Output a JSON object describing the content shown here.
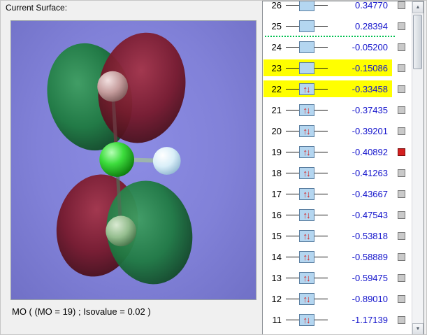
{
  "colors": {
    "viewer_bg": "#8181d8",
    "highlight": "#ffff00",
    "energy_text": "#1414cc",
    "row_line": "#1a1a1a",
    "box_fill": "#b4d6f0",
    "box_border": "#5a7ea0",
    "arrow": "#d42020",
    "checkbox_fill": "#c9c9c9",
    "checkbox_border": "#777777",
    "checkbox_selected": "#d42020",
    "separator": "#00c050"
  },
  "header": {
    "label": "Current Surface:"
  },
  "viewer": {
    "caption": "MO ( (MO = 19) ; Isovalue = 0.02 )"
  },
  "scrollbar": {
    "up_icon": "▲",
    "down_icon": "▼"
  },
  "orbital_list": {
    "arrow_up": "↑",
    "arrow_down": "↓",
    "rows": [
      {
        "index": 26,
        "energy": "0.34770",
        "occupied": false,
        "highlight": false,
        "checked": false
      },
      {
        "index": 25,
        "energy": "0.28394",
        "occupied": false,
        "highlight": false,
        "checked": false,
        "separator_after": true
      },
      {
        "index": 24,
        "energy": "-0.05200",
        "occupied": false,
        "highlight": false,
        "checked": false
      },
      {
        "index": 23,
        "energy": "-0.15086",
        "occupied": false,
        "highlight": true,
        "checked": false
      },
      {
        "index": 22,
        "energy": "-0.33458",
        "occupied": true,
        "highlight": true,
        "checked": false
      },
      {
        "index": 21,
        "energy": "-0.37435",
        "occupied": true,
        "highlight": false,
        "checked": false
      },
      {
        "index": 20,
        "energy": "-0.39201",
        "occupied": true,
        "highlight": false,
        "checked": false
      },
      {
        "index": 19,
        "energy": "-0.40892",
        "occupied": true,
        "highlight": false,
        "checked": true
      },
      {
        "index": 18,
        "energy": "-0.41263",
        "occupied": true,
        "highlight": false,
        "checked": false
      },
      {
        "index": 17,
        "energy": "-0.43667",
        "occupied": true,
        "highlight": false,
        "checked": false
      },
      {
        "index": 16,
        "energy": "-0.47543",
        "occupied": true,
        "highlight": false,
        "checked": false
      },
      {
        "index": 15,
        "energy": "-0.53818",
        "occupied": true,
        "highlight": false,
        "checked": false
      },
      {
        "index": 14,
        "energy": "-0.58889",
        "occupied": true,
        "highlight": false,
        "checked": false
      },
      {
        "index": 13,
        "energy": "-0.59475",
        "occupied": true,
        "highlight": false,
        "checked": false
      },
      {
        "index": 12,
        "energy": "-0.89010",
        "occupied": true,
        "highlight": false,
        "checked": false
      },
      {
        "index": 11,
        "energy": "-1.17139",
        "occupied": true,
        "highlight": false,
        "checked": false
      }
    ]
  }
}
